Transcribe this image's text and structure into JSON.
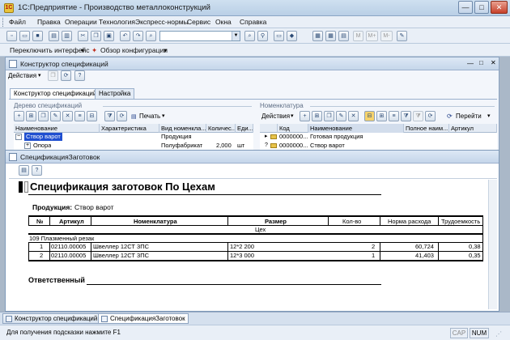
{
  "window": {
    "title": "1С:Предприятие - Производство металлоконструкций",
    "min_label": "—",
    "max_label": "□",
    "close_label": "✕"
  },
  "menu": [
    "Файл",
    "Правка",
    "Операции",
    "Технология",
    "Экспресс-нормы",
    "Сервис",
    "Окна",
    "Справка"
  ],
  "toolbar2": {
    "switch_interface": "Переключить интерфейс",
    "config_overview": "Обзор конфигурации"
  },
  "icons": {
    "toolbar1": [
      "new-document-icon",
      "open-icon",
      "save-icon",
      "print-icon",
      "cut-icon",
      "copy-icon",
      "paste-icon",
      "undo-icon",
      "redo-icon",
      "find-icon",
      "search-next-icon",
      "window-icon",
      "table-icon",
      "spreadsheet-icon",
      "memory-m-icon",
      "memory-m-plus-icon",
      "memory-m-minus-icon",
      "tools-icon"
    ]
  },
  "spec_designer": {
    "title": "Конструктор спецификаций",
    "actions_label": "Действия",
    "help_label": "?",
    "tabs": [
      "Конструктор спецификаций",
      "Настройка"
    ],
    "tree_panel": {
      "title": "Дерево спецификаций",
      "print_label": "Печать",
      "columns": [
        "Наименование",
        "Характеристика",
        "Вид номенкла...",
        "Количес...",
        "Еди..."
      ],
      "rows": [
        {
          "name": "Створ варот",
          "characteristic": "",
          "kind": "Продукция",
          "qty": "",
          "unit": ""
        },
        {
          "name": "Опора",
          "characteristic": "",
          "kind": "Полуфабрикат",
          "qty": "2,000",
          "unit": "шт"
        }
      ]
    },
    "nomenclature_panel": {
      "title": "Номенклатура",
      "actions_label": "Действия",
      "go_label": "Перейти",
      "columns": [
        "Код",
        "Наименование",
        "Полное наим...",
        "Артикул"
      ],
      "rows": [
        {
          "code": "0000000...",
          "name": "Готовая продукция",
          "full_name": "",
          "article": ""
        },
        {
          "code": "0000000...",
          "name": "Створ варот",
          "full_name": "",
          "article": ""
        }
      ]
    }
  },
  "report_window": {
    "title": "СпецификацияЗаготовок",
    "report_title": "Спецификация заготовок По Цехам",
    "product_label": "Продукция:",
    "product_value": "Створ варот",
    "columns": [
      "№",
      "Артикул",
      "Номенклатура",
      "Размер",
      "Кол-во",
      "Норма расхода",
      "Трудоемкость"
    ],
    "subheader": "Цех",
    "group_label": "109 Плазменный резак",
    "rows": [
      {
        "num": "1",
        "article": "02110.00005",
        "name": "Швеллер 12СТ 3ПС",
        "size": "12*2 200",
        "qty": "2",
        "norm": "60,724",
        "labor": "0,38"
      },
      {
        "num": "2",
        "article": "02110.00005",
        "name": "Швеллер 12СТ 3ПС",
        "size": "12*3 000",
        "qty": "1",
        "norm": "41,403",
        "labor": "0,35"
      }
    ],
    "responsible_label": "Ответственный"
  },
  "taskbar": [
    "Конструктор спецификаций",
    "СпецификацияЗаготовок"
  ],
  "status": {
    "hint": "Для получения подсказки нажмите F1",
    "cap": "CAP",
    "num": "NUM"
  },
  "colors": {
    "tree_selected_bg": "#1f4fd0",
    "tree_selected_fg": "#ffffff",
    "title_bar": "#c5d6ea"
  }
}
